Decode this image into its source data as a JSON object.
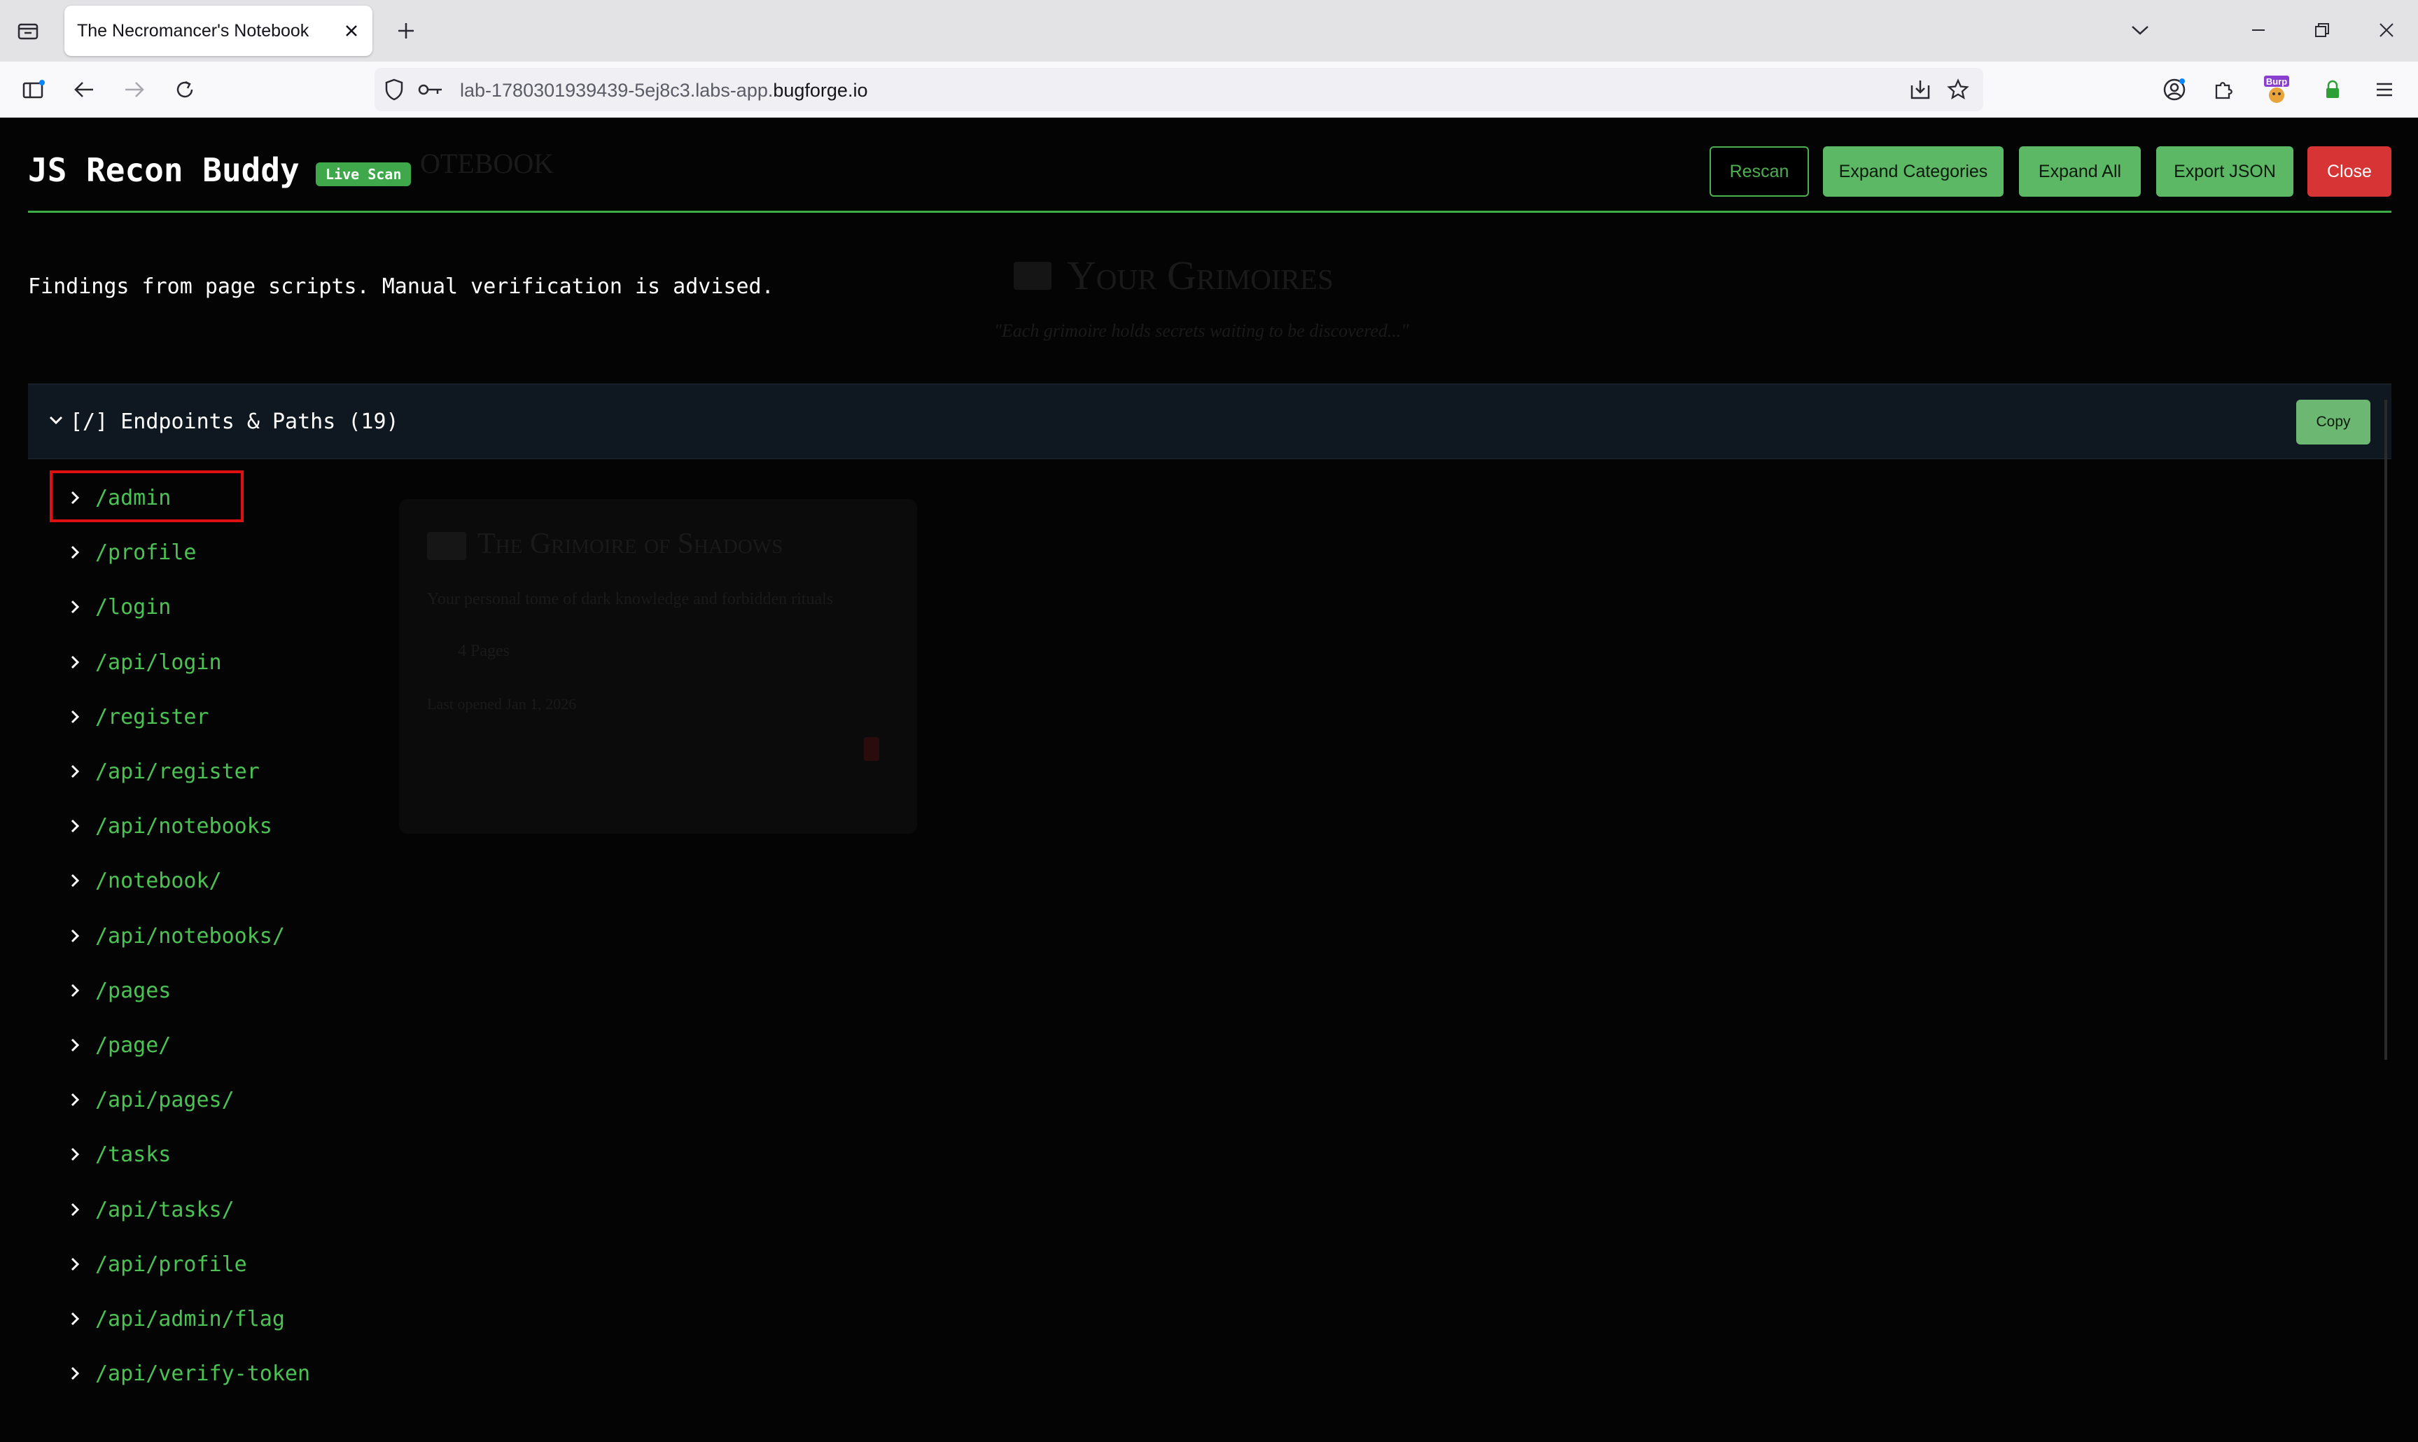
{
  "browser": {
    "tab_title": "The Necromancer's Notebook",
    "url_prefix": "lab-1780301939439-5ej8c3.labs-app.",
    "url_domain": "bugforge.io",
    "extension_badge": "Burp"
  },
  "background_page": {
    "heading_fragment": "OTEBOOK",
    "section_title": "Your Grimoires",
    "section_quote": "\"Each grimoire holds secrets waiting to be discovered...\"",
    "card_title": "The Grimoire of Shadows",
    "card_description": "Your personal tome of dark knowledge and forbidden rituals",
    "card_pages": "4 Pages",
    "card_date": "Last opened Jan 1, 2026"
  },
  "panel": {
    "title": "JS Recon Buddy",
    "badge": "Live Scan",
    "buttons": {
      "rescan": "Rescan",
      "expand_categories": "Expand Categories",
      "expand_all": "Expand All",
      "export_json": "Export JSON",
      "close": "Close"
    },
    "subtitle": "Findings from page scripts. Manual verification is advised.",
    "section": {
      "title": "[/] Endpoints & Paths (19)",
      "copy_label": "Copy",
      "endpoints": [
        "/admin",
        "/profile",
        "/login",
        "/api/login",
        "/register",
        "/api/register",
        "/api/notebooks",
        "/notebook/",
        "/api/notebooks/",
        "/pages",
        "/page/",
        "/api/pages/",
        "/tasks",
        "/api/tasks/",
        "/api/profile",
        "/api/admin/flag",
        "/api/verify-token"
      ]
    }
  },
  "colors": {
    "accent_green": "#4cc254",
    "button_green": "#5cb864",
    "close_red": "#d73535",
    "highlight_red": "#e01010"
  }
}
